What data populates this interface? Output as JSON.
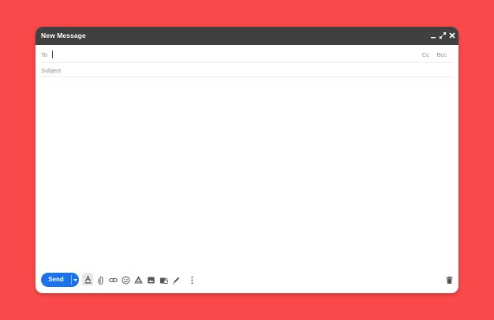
{
  "compose": {
    "title": "New Message",
    "to_label": "To",
    "to_value": "",
    "cc_label": "Cc",
    "bcc_label": "Bcc",
    "subject_placeholder": "Subject",
    "body_value": "",
    "send_label": "Send"
  },
  "icons": {
    "titlebar": [
      "minimize-icon",
      "fullscreen-icon",
      "close-icon"
    ],
    "toolbar": [
      "send-options-icon",
      "formatting-icon",
      "attach-icon",
      "link-icon",
      "emoji-icon",
      "drive-icon",
      "photo-icon",
      "confidential-icon",
      "signature-icon",
      "more-options-icon",
      "trash-icon"
    ]
  },
  "colors": {
    "background": "#fb4a4b",
    "titlebar": "#404040",
    "send_button": "#1a73e8"
  }
}
